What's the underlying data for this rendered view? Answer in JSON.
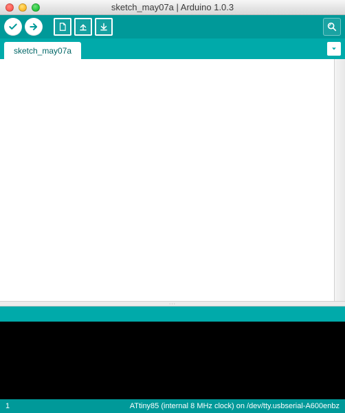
{
  "window": {
    "title": "sketch_may07a | Arduino 1.0.3"
  },
  "toolbar": {
    "verify_tip": "Verify",
    "upload_tip": "Upload",
    "new_tip": "New",
    "open_tip": "Open",
    "save_tip": "Save",
    "serial_tip": "Serial Monitor"
  },
  "tabs": {
    "active": "sketch_may07a"
  },
  "editor": {
    "content": ""
  },
  "divider": {
    "grip": "···"
  },
  "console": {
    "content": ""
  },
  "footer": {
    "line": "1",
    "board": "ATtiny85 (internal 8 MHz clock) on /dev/tty.usbserial-A600enbz"
  }
}
